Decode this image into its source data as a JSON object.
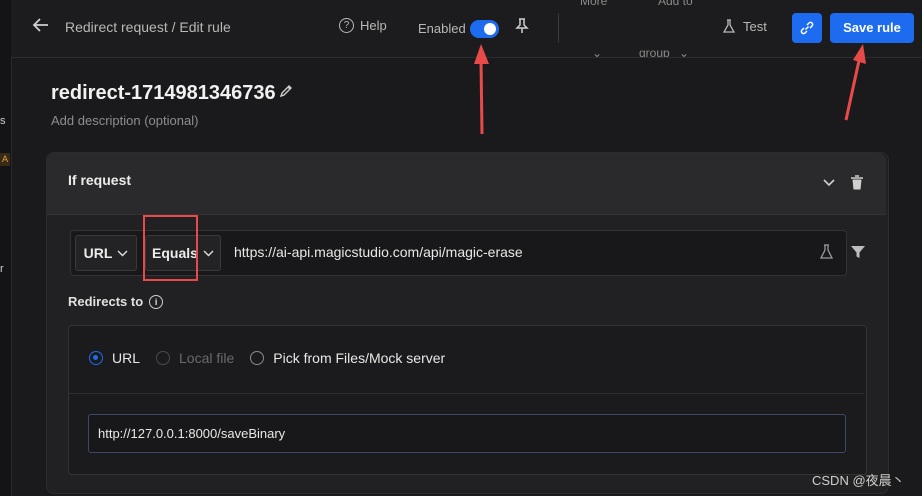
{
  "left_strip": {
    "text_a": "s",
    "badge": "A",
    "text_b": "r"
  },
  "header": {
    "breadcrumb": "Redirect request / Edit rule",
    "help_label": "Help",
    "enabled_label": "Enabled",
    "enabled": true,
    "more_label": "More",
    "add_to_label": "Add to",
    "group_label": "group",
    "test_label": "Test",
    "save_label": "Save rule"
  },
  "rule": {
    "name": "redirect-1714981346736",
    "description_placeholder": "Add description (optional)"
  },
  "condition": {
    "section_title": "If request",
    "source_key": "URL",
    "operator": "Equals",
    "value": "https://ai-api.magicstudio.com/api/magic-erase"
  },
  "destination": {
    "label": "Redirects to",
    "options": [
      {
        "label": "URL",
        "selected": true,
        "disabled": false
      },
      {
        "label": "Local file",
        "selected": false,
        "disabled": true
      },
      {
        "label": "Pick from Files/Mock server",
        "selected": false,
        "disabled": false
      }
    ],
    "url_value": "http://127.0.0.1:8000/saveBinary"
  },
  "watermark": "CSDN @夜晨丶",
  "colors": {
    "accent": "#1d6cf0",
    "annotation": "#e84a4a",
    "background": "#1a1a1c"
  }
}
